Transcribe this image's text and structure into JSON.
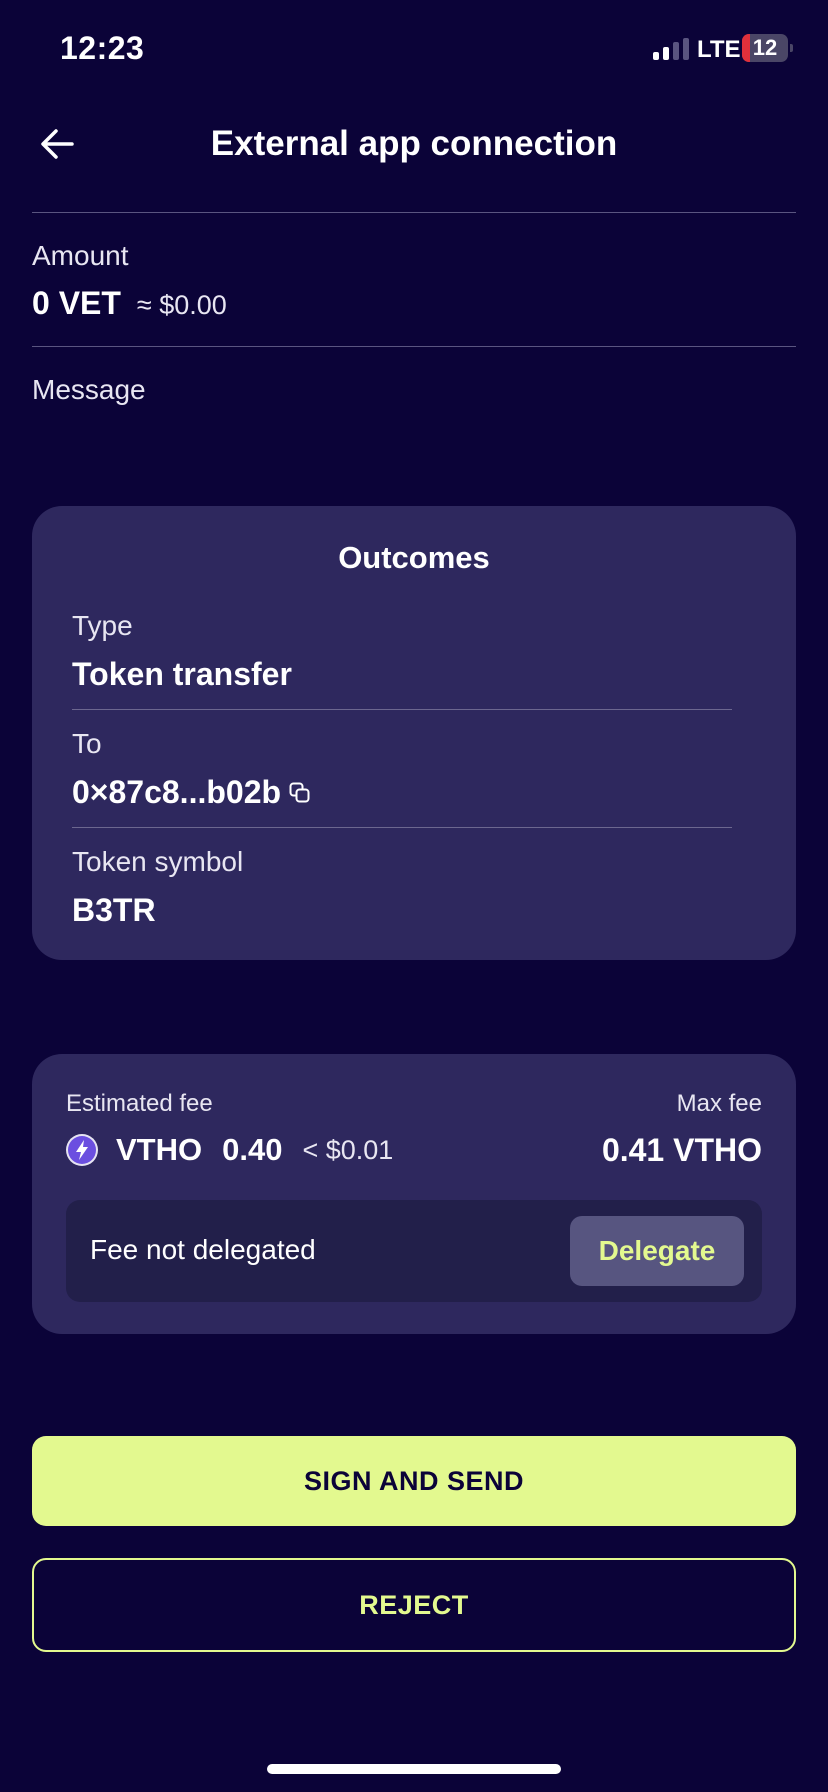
{
  "status_bar": {
    "time": "12:23",
    "network": "LTE",
    "battery": "12"
  },
  "header": {
    "title": "External app connection",
    "back_icon": "arrow-left-icon"
  },
  "amount": {
    "label": "Amount",
    "value": "0 VET",
    "usd": "≈ $0.00"
  },
  "message": {
    "label": "Message"
  },
  "outcomes": {
    "title": "Outcomes",
    "type_label": "Type",
    "type_value": "Token transfer",
    "to_label": "To",
    "to_value": "0×87c8...b02b",
    "copy_icon": "copy-icon",
    "symbol_label": "Token symbol",
    "symbol_value": "B3TR"
  },
  "fee": {
    "estimated_label": "Estimated fee",
    "token": "VTHO",
    "amount": "0.40",
    "usd": "< $0.01",
    "max_label": "Max fee",
    "max_value": "0.41 VTHO",
    "delegation_status": "Fee not delegated",
    "delegate_label": "Delegate"
  },
  "actions": {
    "sign_label": "SIGN AND SEND",
    "reject_label": "REJECT"
  },
  "colors": {
    "background": "#0b0338",
    "card": "#2e285e",
    "accent": "#e3f98f"
  }
}
